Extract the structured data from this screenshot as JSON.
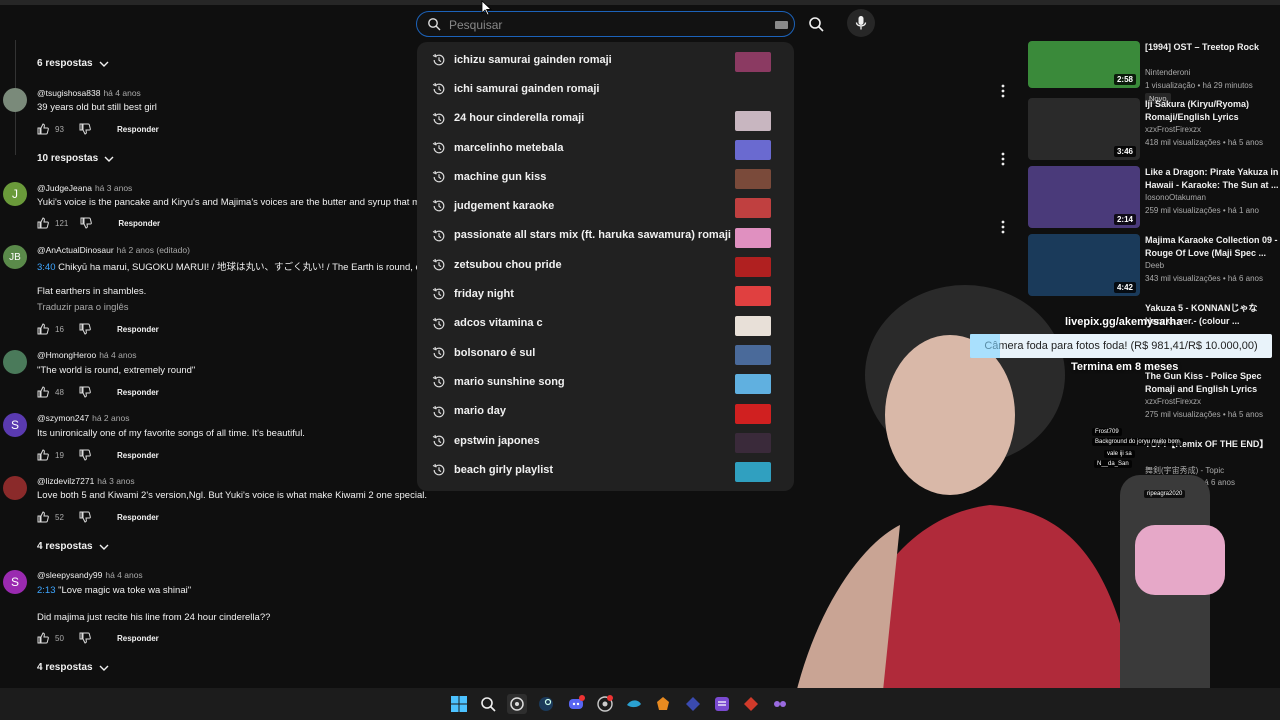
{
  "search": {
    "placeholder": "Pesquisar",
    "value": ""
  },
  "suggestions": [
    {
      "text": "ichizu samurai gainden romaji",
      "thumb": "#8b3a62"
    },
    {
      "text": "ichi samurai gainden romaji",
      "thumb": ""
    },
    {
      "text": "24 hour cinderella romaji",
      "thumb": "#c8b6c0"
    },
    {
      "text": "marcelinho metebala",
      "thumb": "#6a6ad0"
    },
    {
      "text": "machine gun kiss",
      "thumb": "#7a4a3a"
    },
    {
      "text": "judgement karaoke",
      "thumb": "#c04040"
    },
    {
      "text": "passionate all stars mix (ft. haruka sawamura) romaji",
      "thumb": "#e090c0"
    },
    {
      "text": "zetsubou chou pride",
      "thumb": "#b02020"
    },
    {
      "text": "friday night",
      "thumb": "#e04040"
    },
    {
      "text": "adcos vitamina c",
      "thumb": "#e8e0d8"
    },
    {
      "text": "bolsonaro é sul",
      "thumb": "#4a6a9a"
    },
    {
      "text": "mario sunshine song",
      "thumb": "#60b0e0"
    },
    {
      "text": "mario day",
      "thumb": "#d02020"
    },
    {
      "text": "epstwin japones",
      "thumb": "#3a2a3a"
    },
    {
      "text": "beach girly playlist",
      "thumb": "#30a0c0"
    }
  ],
  "comments": {
    "replies_1": "6 respostas",
    "c1": {
      "initial": "",
      "author": "@tsugishosa838",
      "time": "há 4 anos",
      "text": "39 years old but still best girl",
      "likes": "93",
      "reply": "Responder"
    },
    "replies_2": "10 respostas",
    "c2": {
      "initial": "J",
      "author": "@JudgeJeana",
      "time": "há 3 anos",
      "text": "Yuki's voice is the pancake and Kiryu's and Majima's voices are the butter and syrup that me",
      "likes": "121",
      "reply": "Responder"
    },
    "c3": {
      "initial": "JB",
      "author": "@AnActualDinosaur",
      "time": "há 2 anos (editado)",
      "ts": "3:40",
      "text": " Chikyū ha marui, SUGOKU MARUI! / 地球は丸い、すごく丸い! / The Earth is round, ext",
      "text2": "Flat earthers in shambles.",
      "translate": "Traduzir para o inglês",
      "likes": "16",
      "reply": "Responder"
    },
    "c4": {
      "initial": "",
      "author": "@HmongHeroo",
      "time": "há 4 anos",
      "text": "\"The world is round, extremely round\"",
      "likes": "48",
      "reply": "Responder"
    },
    "c5": {
      "initial": "S",
      "author": "@szymon247",
      "time": "há 2 anos",
      "text": "Its unironically one of my favorite songs of all time. It's beautiful.",
      "likes": "19",
      "reply": "Responder"
    },
    "c6": {
      "initial": "",
      "author": "@lizdevilz7271",
      "time": "há 3 anos",
      "text": "Love both 5 and Kiwami 2's version,Ngl. But Yuki's voice is what make Kiwami 2 one special.",
      "likes": "52",
      "reply": "Responder"
    },
    "replies_3": "4 respostas",
    "c7": {
      "initial": "S",
      "author": "@sleepysandy99",
      "time": "há 4 anos",
      "ts": "2:13",
      "text": " \"Love magic wa toke wa shinai\"",
      "text2": "Did majima just recite his line from 24 hour cinderella??",
      "likes": "50",
      "reply": "Responder"
    },
    "replies_4": "4 respostas"
  },
  "videos": [
    {
      "title": "[1994] OST – Treetop Rock",
      "channel": "Nintenderoni",
      "meta": "1 visualização • há 29 minutos",
      "badge": "Novo",
      "duration": "2:58",
      "color": "#3a8a3a"
    },
    {
      "title": "Iji Sakura (Kiryu/Ryoma) Romaji/English Lyrics",
      "channel": "xzxFrostFirexzx",
      "meta": "418 mil visualizações • há 5 anos",
      "duration": "3:46",
      "color": "#2a2a2a"
    },
    {
      "title": "Like a Dragon: Pirate Yakuza in Hawaii - Karaoke: The Sun at ...",
      "channel": "IosonoOtakuman",
      "meta": "259 mil visualizações • há 1 ano",
      "duration": "2:14",
      "color": "#4a3a7a"
    },
    {
      "title": "Majima Karaoke Collection 09 - Rouge Of Love (Maji Spec ...",
      "channel": "Deeb",
      "meta": "343 mil visualizações • há 6 anos",
      "duration": "4:42",
      "color": "#1a3a5a"
    },
    {
      "title": "Yakuza 5 - KONNANじゃな Haruka ver.- (colour ...",
      "channel": "",
      "meta": "",
      "duration": "",
      "color": ""
    },
    {
      "title": "The Gun Kiss - Police Spec Romaji and English Lyrics",
      "channel": "xzxFrostFirexzx",
      "meta": "275 mil visualizações • há 5 anos",
      "duration": "",
      "color": ""
    },
    {
      "title": "TOP!【Remix OF THE END】",
      "channel": "舞剣(宇宙秀成) - Topic",
      "meta": "visualizações • há 6 anos",
      "duration": "",
      "color": ""
    }
  ],
  "overlay": {
    "link": "livepix.gg/akemysarha",
    "tip": "Câmera foda para fotos foda! (R$ 981,41/R$ 10.000,00)",
    "ends": "Termina em 8 meses",
    "chat": [
      "Frost709",
      "Background do joryu muito bom",
      "vale iji sa",
      "N__da_San",
      "ripeagra2020"
    ]
  },
  "colors": {
    "accent": "#3ea6ff",
    "searchBorder": "#1c62b9"
  }
}
